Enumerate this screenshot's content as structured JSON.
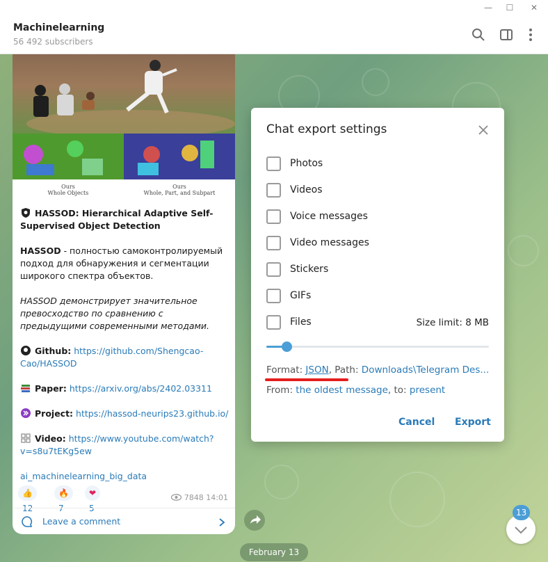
{
  "window": {
    "minimize_glyph": "—",
    "maximize_glyph": "☐",
    "close_glyph": "✕"
  },
  "channel": {
    "title": "Machinelearning",
    "subscribers": "56 492 subscribers"
  },
  "post": {
    "image_captions": [
      {
        "title": "Ours",
        "sub": "Whole Objects"
      },
      {
        "title": "Ours",
        "sub": "Whole, Part, and Subpart"
      }
    ],
    "heading": "HASSOD: Hierarchical Adaptive Self-Supervised Object Detection",
    "intro_bold": "HASSOD",
    "intro_rest": " - полностью самоконтролируемый подход для обнаружения и сегментации широкого спектра объектов.",
    "italic_text": "HASSOD демонстрирует значительное превосходство по сравнению с предыдущими современными методами.",
    "links": [
      {
        "label": "Github:",
        "url": "https://github.com/Shengcao-Cao/HASSOD",
        "icon": "github-icon"
      },
      {
        "label": "Paper:",
        "url": "https://arxiv.org/abs/2402.03311",
        "icon": "books-icon"
      },
      {
        "label": "Project:",
        "url": "https://hassod-neurips23.github.io/",
        "icon": "project-icon"
      },
      {
        "label": "Video:",
        "url": "https://www.youtube.com/watch?v=s8u7tEKg5ew",
        "icon": "video-icon"
      }
    ],
    "hashtag": "ai_machinelearning_big_data",
    "reactions": [
      {
        "emoji": "👍",
        "count": "12"
      },
      {
        "emoji": "🔥",
        "count": "7"
      },
      {
        "emoji": "❤",
        "count": "5"
      }
    ],
    "views": "7848",
    "time": "14:01",
    "comment_label": "Leave a comment"
  },
  "date_pill": "February 13",
  "unread_count": "13",
  "export_dialog": {
    "title": "Chat export settings",
    "options": [
      {
        "label": "Photos",
        "checked": false
      },
      {
        "label": "Videos",
        "checked": false
      },
      {
        "label": "Voice messages",
        "checked": false
      },
      {
        "label": "Video messages",
        "checked": false
      },
      {
        "label": "Stickers",
        "checked": false
      },
      {
        "label": "GIFs",
        "checked": false
      },
      {
        "label": "Files",
        "checked": false
      }
    ],
    "size_limit": "Size limit: 8 MB",
    "slider_fraction": 0.09,
    "format_label": "Format: ",
    "format_value": "JSON",
    "path_label": ", Path: ",
    "path_value": "Downloads\\Telegram Des...",
    "from_label": "From: ",
    "from_value": "the oldest message",
    "to_label": ", to: ",
    "to_value": "present",
    "cancel_label": "Cancel",
    "export_label": "Export"
  },
  "colors": {
    "accent": "#2a7bb8",
    "slider": "#4b9ed6",
    "highlight": "#e41e1e"
  }
}
